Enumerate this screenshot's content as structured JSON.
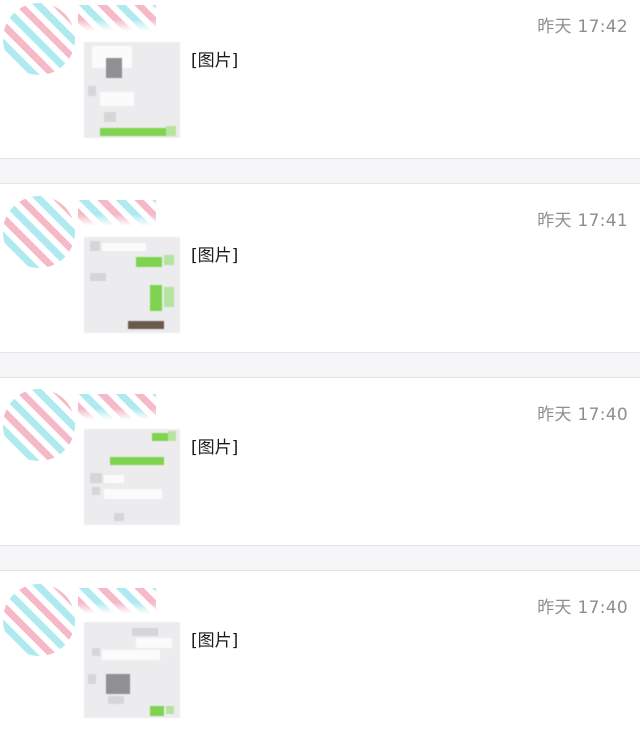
{
  "feed": {
    "items": [
      {
        "timestamp": "昨天 17:42",
        "caption": "[图片]",
        "avatar_icon": "striped-avatar-icon"
      },
      {
        "timestamp": "昨天 17:41",
        "caption": "[图片]",
        "avatar_icon": "striped-avatar-icon"
      },
      {
        "timestamp": "昨天 17:40",
        "caption": "[图片]",
        "avatar_icon": "striped-avatar-icon"
      },
      {
        "timestamp": "昨天 17:40",
        "caption": "[图片]",
        "avatar_icon": "striped-avatar-icon"
      }
    ]
  },
  "colors": {
    "card_background": "#ffffff",
    "page_background": "#f6f6f8",
    "timestamp_text": "#8d8d92",
    "stripe_pink": "#f5b9c8",
    "stripe_cyan": "#aeeaf0",
    "chat_bubble_green": "#7ed34f"
  }
}
